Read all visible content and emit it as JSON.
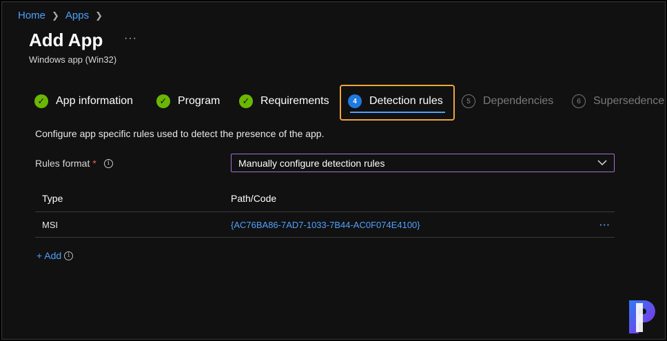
{
  "breadcrumb": [
    "Home",
    "Apps"
  ],
  "page": {
    "title": "Add App",
    "more_label": "···",
    "subtitle": "Windows app (Win32)"
  },
  "tabs": [
    {
      "label": "App information",
      "state": "complete",
      "indicator": "✓"
    },
    {
      "label": "Program",
      "state": "complete",
      "indicator": "✓"
    },
    {
      "label": "Requirements",
      "state": "complete",
      "indicator": "✓"
    },
    {
      "label": "Detection rules",
      "state": "active",
      "indicator": "4"
    },
    {
      "label": "Dependencies",
      "state": "disabled",
      "indicator": "5"
    },
    {
      "label": "Supersedence (",
      "state": "disabled",
      "indicator": "6"
    }
  ],
  "description": "Configure app specific rules used to detect the presence of the app.",
  "rules_format": {
    "label": "Rules format",
    "required_mark": "*",
    "info_glyph": "i",
    "selected": "Manually configure detection rules"
  },
  "table": {
    "headers": [
      "Type",
      "Path/Code"
    ],
    "rows": [
      {
        "type": "MSI",
        "path": "{AC76BA86-7AD7-1033-7B44-AC0F074E4100}",
        "more": "···"
      }
    ]
  },
  "add_link": {
    "label": "+ Add",
    "info_glyph": "i"
  },
  "colors": {
    "accent_link": "#4ea1ff",
    "complete": "#6bb700",
    "active_step": "#1f7ae0",
    "highlight_box": "#f0a63a",
    "select_border": "#a56ed1",
    "logo_blue": "#2e7cf6",
    "logo_purple": "#8a2be2"
  },
  "icons": [
    "check-icon",
    "info-icon",
    "chevron-down-icon",
    "chevron-right-icon",
    "ellipsis-icon",
    "brand-logo-icon"
  ]
}
